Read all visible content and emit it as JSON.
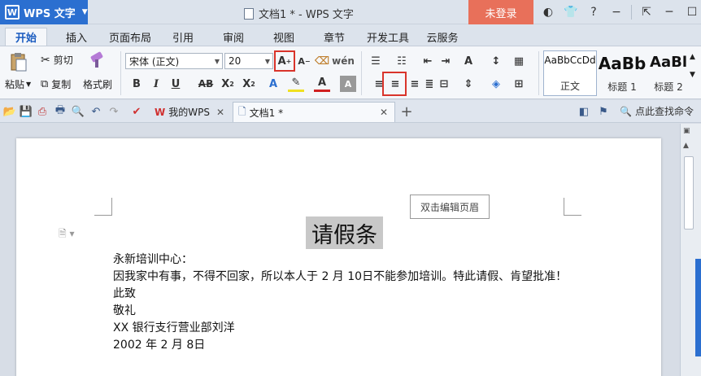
{
  "app": {
    "name": "WPS 文字"
  },
  "window": {
    "title": "文档1 * - WPS 文字",
    "login_label": "未登录"
  },
  "menu_tabs": [
    "开始",
    "插入",
    "页面布局",
    "引用",
    "审阅",
    "视图",
    "章节",
    "开发工具",
    "云服务"
  ],
  "ribbon": {
    "clipboard": {
      "cut": "剪切",
      "paste": "粘贴",
      "copy": "复制",
      "format_painter": "格式刷"
    },
    "font": {
      "name": "宋体 (正文)",
      "size": "20"
    },
    "styles": [
      {
        "preview": "AaBbCcDd",
        "name": "正文"
      },
      {
        "preview": "AaBb",
        "name": "标题 1"
      },
      {
        "preview": "AaBl",
        "name": "标题 2"
      }
    ]
  },
  "doc_tabs": [
    {
      "label": "我的WPS"
    },
    {
      "label": "文档1 *"
    }
  ],
  "search_cmd": "点此查找命令",
  "document": {
    "header_hint": "双击编辑页眉",
    "heading": "请假条",
    "lines": [
      "永新培训中心：",
      "因我家中有事，不得不回家，所以本人于 2 月 10日不能参加培训。特此请假、肯望批准！",
      "此致",
      "敬礼",
      "XX 银行支行营业部刘洋",
      "2002 年 2 月 8日"
    ]
  },
  "colors": {
    "accent": "#2b6fd0",
    "login": "#e8705a",
    "highlight_box": "#d9342b"
  }
}
